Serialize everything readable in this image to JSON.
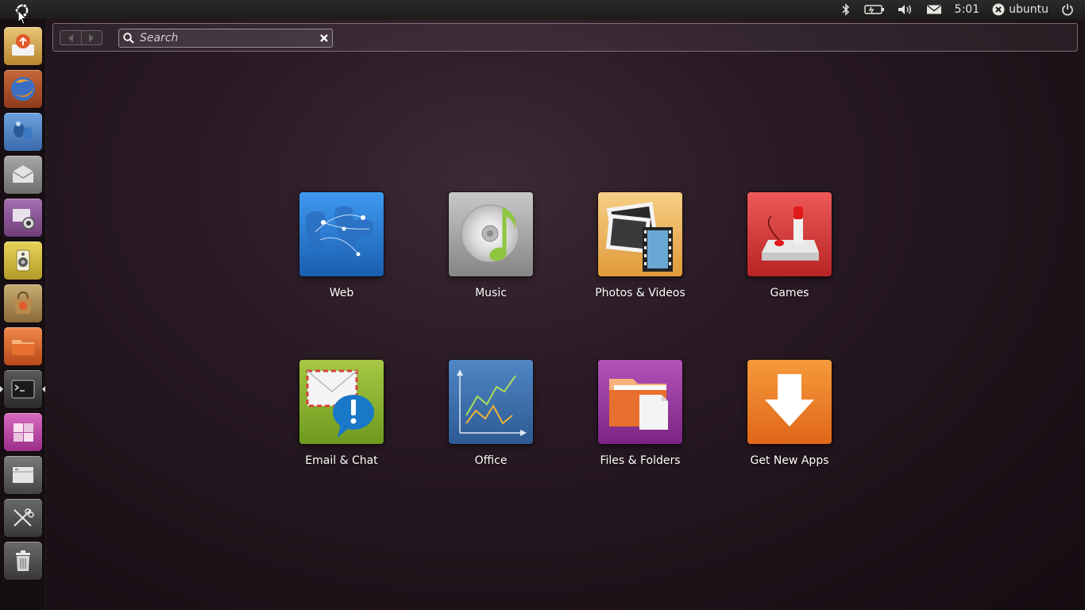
{
  "top_panel": {
    "clock": "5:01",
    "user": "ubuntu",
    "icons": [
      "ubuntu-logo-icon",
      "bluetooth-icon",
      "battery-icon",
      "volume-icon",
      "mail-icon",
      "session-x-icon",
      "power-icon"
    ]
  },
  "launcher": {
    "items": [
      {
        "name": "update-manager",
        "icon": "update-manager-icon",
        "color": "#d8b15a"
      },
      {
        "name": "firefox",
        "icon": "firefox-icon",
        "color": "#b5562a"
      },
      {
        "name": "empathy",
        "icon": "empathy-icon",
        "color": "#4f86c6"
      },
      {
        "name": "mail",
        "icon": "mail-envelope-icon",
        "color": "#9a9a9a"
      },
      {
        "name": "cheese",
        "icon": "webcam-icon",
        "color": "#8e5a9a"
      },
      {
        "name": "speaker",
        "icon": "speaker-icon",
        "color": "#d8c24a"
      },
      {
        "name": "software-center",
        "icon": "software-center-icon",
        "color": "#b89a5a"
      },
      {
        "name": "files",
        "icon": "folder-icon",
        "color": "#d96a30"
      },
      {
        "name": "terminal",
        "icon": "terminal-icon",
        "color": "#3a3a3a"
      },
      {
        "name": "workspaces",
        "icon": "workspace-switcher-icon",
        "color": "#c34fa8"
      },
      {
        "name": "file-browser",
        "icon": "file-cabinet-icon",
        "color": "#5a5a5a"
      },
      {
        "name": "screenshot",
        "icon": "screenshot-icon",
        "color": "#4a4a4a"
      },
      {
        "name": "trash",
        "icon": "trash-icon",
        "color": "#4a4a4a"
      }
    ]
  },
  "dash": {
    "search_placeholder": "Search",
    "search_value": "",
    "tiles": [
      {
        "label": "Web",
        "icon": "web-globe-icon",
        "color": "#2a7fd4"
      },
      {
        "label": "Music",
        "icon": "music-cd-icon",
        "color": "#a8a8a8"
      },
      {
        "label": "Photos & Videos",
        "icon": "photos-videos-icon",
        "color": "#e8b35a"
      },
      {
        "label": "Games",
        "icon": "games-joystick-icon",
        "color": "#d43a3a"
      },
      {
        "label": "Email & Chat",
        "icon": "email-chat-icon",
        "color": "#8ab02a"
      },
      {
        "label": "Office",
        "icon": "office-chart-icon",
        "color": "#3a6fae"
      },
      {
        "label": "Files & Folders",
        "icon": "files-folders-icon",
        "color": "#9a3aa0"
      },
      {
        "label": "Get New Apps",
        "icon": "download-arrow-icon",
        "color": "#f07a1a"
      }
    ]
  }
}
